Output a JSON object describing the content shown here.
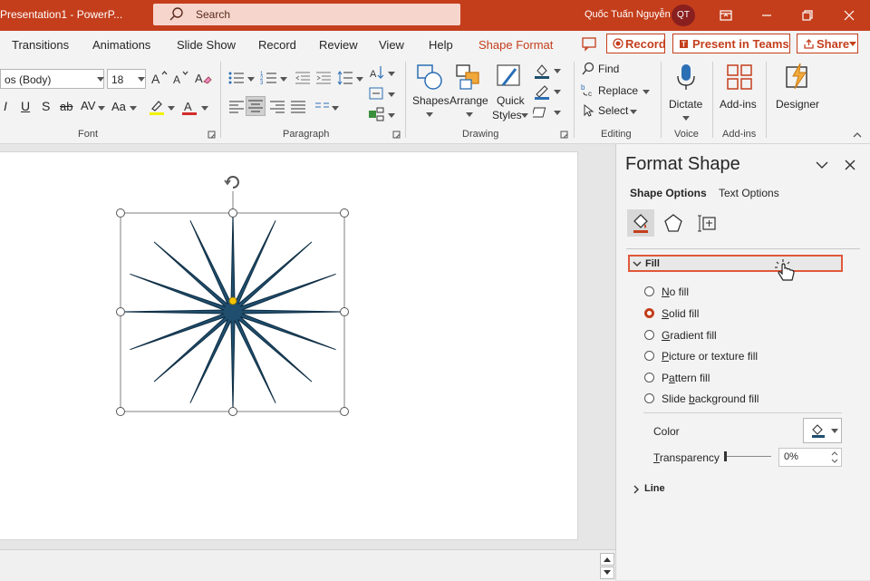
{
  "app": {
    "title": "Presentation1  -  PowerP...",
    "search_placeholder": "Search",
    "user_name": "Quốc Tuấn Nguyễn",
    "user_initials": "QT"
  },
  "tabs": [
    {
      "label": "Transitions"
    },
    {
      "label": "Animations"
    },
    {
      "label": "Slide Show"
    },
    {
      "label": "Record"
    },
    {
      "label": "Review"
    },
    {
      "label": "View"
    },
    {
      "label": "Help"
    },
    {
      "label": "Shape Format",
      "active": true
    }
  ],
  "top_buttons": {
    "record": "Record",
    "present": "Present in Teams",
    "share": "Share"
  },
  "ribbon": {
    "font": {
      "label": "Font",
      "font_name": "os (Body)",
      "font_size": "18",
      "change_case": "Aa"
    },
    "paragraph": {
      "label": "Paragraph"
    },
    "drawing": {
      "label": "Drawing",
      "shapes": "Shapes",
      "arrange": "Arrange",
      "quick": "Quick",
      "styles": "Styles"
    },
    "editing": {
      "label": "Editing",
      "find": "Find",
      "replace": "Replace",
      "select": "Select"
    },
    "voice": {
      "label": "Voice",
      "dictate": "Dictate"
    },
    "addins": {
      "label": "Add-ins",
      "addins": "Add-ins"
    },
    "designer": {
      "designer": "Designer"
    }
  },
  "pane": {
    "title": "Format Shape",
    "tab_shape": "Shape Options",
    "tab_text": "Text Options",
    "fill_header": "Fill",
    "fill_options": [
      {
        "pre": "",
        "u": "N",
        "post": "o fill",
        "checked": false
      },
      {
        "pre": "",
        "u": "S",
        "post": "olid fill",
        "checked": true
      },
      {
        "pre": "",
        "u": "G",
        "post": "radient fill",
        "checked": false
      },
      {
        "pre": "",
        "u": "P",
        "post": "icture or texture fill",
        "checked": false
      },
      {
        "pre": "P",
        "u": "a",
        "post": "ttern fill",
        "checked": false
      },
      {
        "pre": "Slide ",
        "u": "b",
        "post": "ackground fill",
        "checked": false
      }
    ],
    "color_label": "Color",
    "transparency_label_u": "T",
    "transparency_label_rest": "ransparency",
    "transparency_value": "0%",
    "line_header": "Line"
  },
  "colors": {
    "accent": "#c43e1c",
    "star_fill": "#1f4e6e"
  },
  "icons": {
    "search": "search-icon",
    "rotate": "rotate-handle-icon",
    "cursor": "hand-pointer-icon"
  }
}
